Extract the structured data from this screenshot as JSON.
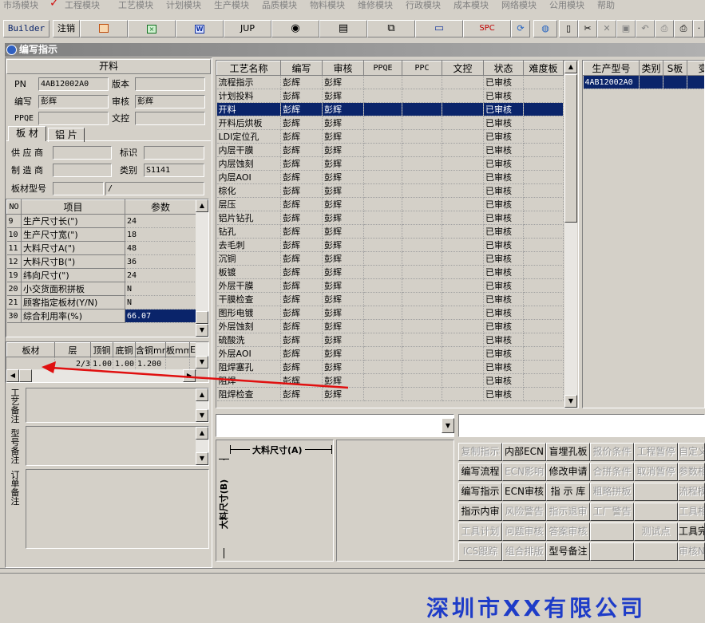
{
  "menu": [
    "市场模块",
    "工程模块",
    "工艺模块",
    "计划模块",
    "生产模块",
    "品质模块",
    "物料模块",
    "维修模块",
    "行政模块",
    "成本模块",
    "网络模块",
    "公用模块",
    "帮助"
  ],
  "toolbar": {
    "builder": "Builder",
    "logout": "注销",
    "jup": "JUP",
    "spc": "SPC"
  },
  "window_title": "编写指示",
  "left": {
    "section_title": "开料",
    "pn_label": "PN",
    "pn_value": "4AB12002A0",
    "version_label": "版本",
    "version_value": "",
    "writer_label": "编写",
    "writer_value": "彭辉",
    "review_label": "审核",
    "review_value": "彭辉",
    "ppqe_label": "PPQE",
    "ppqe_value": "",
    "doc_label": "文控",
    "doc_value": "",
    "tab_board": "板 材",
    "tab_al": "铝 片",
    "supplier_label": "供 应 商",
    "supplier_value": "",
    "mark_label": "标识",
    "mark_value": "",
    "maker_label": "制 造 商",
    "maker_value": "",
    "type_label": "类别",
    "type_value": "S1141",
    "model_label": "板材型号",
    "model_value": "",
    "model_value2": "/",
    "param_headers": [
      "NO",
      "项目",
      "参数"
    ],
    "params": [
      {
        "no": "9",
        "item": "生产尺寸长(\")",
        "value": "24"
      },
      {
        "no": "10",
        "item": "生产尺寸宽(\")",
        "value": "18"
      },
      {
        "no": "11",
        "item": "大料尺寸A(\")",
        "value": "48"
      },
      {
        "no": "12",
        "item": "大料尺寸B(\")",
        "value": "36"
      },
      {
        "no": "19",
        "item": "纬向尺寸(\")",
        "value": "24"
      },
      {
        "no": "20",
        "item": "小交货面积拼板",
        "value": "N"
      },
      {
        "no": "21",
        "item": "顾客指定板材(Y/N)",
        "value": "N"
      },
      {
        "no": "30",
        "item": "综合利用率(%)",
        "value": "66.07"
      }
    ],
    "layer_headers": [
      "板材",
      "层",
      "顶铜",
      "底铜",
      "含铜mm",
      "板mm",
      "E"
    ],
    "layer_row": [
      "",
      "2/3",
      "1.00",
      "1.00",
      "1.200",
      "",
      ""
    ],
    "notes": [
      "工艺备注",
      "型号备注",
      "订单备注"
    ]
  },
  "process": {
    "headers": [
      "工艺名称",
      "编写",
      "审核",
      "PPQE",
      "PPC",
      "文控",
      "状态",
      "难度板"
    ],
    "selected_index": 2,
    "rows": [
      [
        "流程指示",
        "彭辉",
        "彭辉",
        "",
        "",
        "",
        "已审核",
        ""
      ],
      [
        "计划投料",
        "彭辉",
        "彭辉",
        "",
        "",
        "",
        "已审核",
        ""
      ],
      [
        "开料",
        "彭辉",
        "彭辉",
        "",
        "",
        "",
        "已审核",
        ""
      ],
      [
        "开料后烘板",
        "彭辉",
        "彭辉",
        "",
        "",
        "",
        "已审核",
        ""
      ],
      [
        "LDI定位孔",
        "彭辉",
        "彭辉",
        "",
        "",
        "",
        "已审核",
        ""
      ],
      [
        "内层干膜",
        "彭辉",
        "彭辉",
        "",
        "",
        "",
        "已审核",
        ""
      ],
      [
        "内层蚀刻",
        "彭辉",
        "彭辉",
        "",
        "",
        "",
        "已审核",
        ""
      ],
      [
        "内层AOI",
        "彭辉",
        "彭辉",
        "",
        "",
        "",
        "已审核",
        ""
      ],
      [
        "棕化",
        "彭辉",
        "彭辉",
        "",
        "",
        "",
        "已审核",
        ""
      ],
      [
        "层压",
        "彭辉",
        "彭辉",
        "",
        "",
        "",
        "已审核",
        ""
      ],
      [
        "铝片钻孔",
        "彭辉",
        "彭辉",
        "",
        "",
        "",
        "已审核",
        ""
      ],
      [
        "钻孔",
        "彭辉",
        "彭辉",
        "",
        "",
        "",
        "已审核",
        ""
      ],
      [
        "去毛刺",
        "彭辉",
        "彭辉",
        "",
        "",
        "",
        "已审核",
        ""
      ],
      [
        "沉铜",
        "彭辉",
        "彭辉",
        "",
        "",
        "",
        "已审核",
        ""
      ],
      [
        "板镀",
        "彭辉",
        "彭辉",
        "",
        "",
        "",
        "已审核",
        ""
      ],
      [
        "外层干膜",
        "彭辉",
        "彭辉",
        "",
        "",
        "",
        "已审核",
        ""
      ],
      [
        "干膜检查",
        "彭辉",
        "彭辉",
        "",
        "",
        "",
        "已审核",
        ""
      ],
      [
        "图形电镀",
        "彭辉",
        "彭辉",
        "",
        "",
        "",
        "已审核",
        ""
      ],
      [
        "外层蚀刻",
        "彭辉",
        "彭辉",
        "",
        "",
        "",
        "已审核",
        ""
      ],
      [
        "硫酸洗",
        "彭辉",
        "彭辉",
        "",
        "",
        "",
        "已审核",
        ""
      ],
      [
        "外层AOI",
        "彭辉",
        "彭辉",
        "",
        "",
        "",
        "已审核",
        ""
      ],
      [
        "阻焊塞孔",
        "彭辉",
        "彭辉",
        "",
        "",
        "",
        "已审核",
        ""
      ],
      [
        "阻焊",
        "彭辉",
        "彭辉",
        "",
        "",
        "",
        "已审核",
        ""
      ],
      [
        "阻焊检查",
        "彭辉",
        "彭辉",
        "",
        "",
        "",
        "已审核",
        ""
      ]
    ]
  },
  "right": {
    "headers": [
      "生产型号",
      "类别",
      "S板",
      "变"
    ],
    "rows": [
      [
        "4AB12002A0",
        "",
        "",
        ""
      ]
    ]
  },
  "diagram": {
    "dim_a": "大料尺寸(A)",
    "dim_b": "大料尺寸(B)"
  },
  "buttons": [
    [
      {
        "label": "复制指示",
        "enabled": false
      },
      {
        "label": "内部ECN",
        "enabled": true
      },
      {
        "label": "盲埋孔板",
        "enabled": true
      },
      {
        "label": "报价条件",
        "enabled": false
      },
      {
        "label": "工程暂停",
        "enabled": false
      },
      {
        "label": "自定义",
        "enabled": false
      }
    ],
    [
      {
        "label": "编写流程",
        "enabled": true
      },
      {
        "label": "ECN影响",
        "enabled": false
      },
      {
        "label": "修改申请",
        "enabled": true
      },
      {
        "label": "合拼条件",
        "enabled": false
      },
      {
        "label": "取消暂停",
        "enabled": false
      },
      {
        "label": "参数相",
        "enabled": false
      }
    ],
    [
      {
        "label": "编写指示",
        "enabled": true
      },
      {
        "label": "ECN审核",
        "enabled": true
      },
      {
        "label": "指 示 库",
        "enabled": true
      },
      {
        "label": "粗略拼板",
        "enabled": false
      },
      {
        "label": "",
        "enabled": false
      },
      {
        "label": "流程模",
        "enabled": false
      }
    ],
    [
      {
        "label": "指示内审",
        "enabled": true
      },
      {
        "label": "风险警告",
        "enabled": false
      },
      {
        "label": "指示退审",
        "enabled": false
      },
      {
        "label": "工厂警告",
        "enabled": false
      },
      {
        "label": "",
        "enabled": false
      },
      {
        "label": "工具相",
        "enabled": false
      }
    ],
    [
      {
        "label": "工具计划",
        "enabled": false
      },
      {
        "label": "问题审核",
        "enabled": false
      },
      {
        "label": "答案审核",
        "enabled": false
      },
      {
        "label": "",
        "enabled": false
      },
      {
        "label": "测试点",
        "enabled": false
      },
      {
        "label": "工具完",
        "enabled": true
      }
    ],
    [
      {
        "label": "ICS跟踪",
        "enabled": false
      },
      {
        "label": "组合排版",
        "enabled": false
      },
      {
        "label": "型号备注",
        "enabled": true
      },
      {
        "label": "",
        "enabled": false
      },
      {
        "label": "",
        "enabled": false
      },
      {
        "label": "审核N",
        "enabled": false
      }
    ]
  ],
  "colors": {
    "selection": "#0a246a",
    "window_bg": "#d4d0c8",
    "arrow": "#e01010",
    "footer_text": "#1e3cc8"
  },
  "footer_text": "深圳市XX有限公司"
}
